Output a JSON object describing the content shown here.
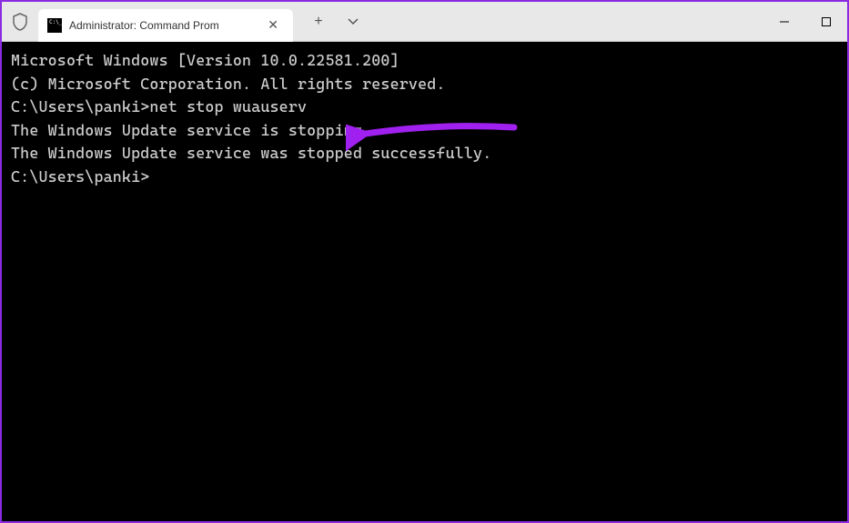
{
  "titlebar": {
    "tab_title": "Administrator: Command Prom",
    "tab_icon_text": "C:\\_"
  },
  "terminal": {
    "line1": "Microsoft Windows [Version 10.0.22581.200]",
    "line2": "(c) Microsoft Corporation. All rights reserved.",
    "blank1": "",
    "prompt1": "C:\\Users\\panki>",
    "command1": "net stop wuauserv",
    "output1": "The Windows Update service is stopping.",
    "output2": "The Windows Update service was stopped successfully.",
    "blank2": "",
    "blank3": "",
    "prompt2": "C:\\Users\\panki>"
  },
  "annotation": {
    "color": "#a020f0"
  }
}
